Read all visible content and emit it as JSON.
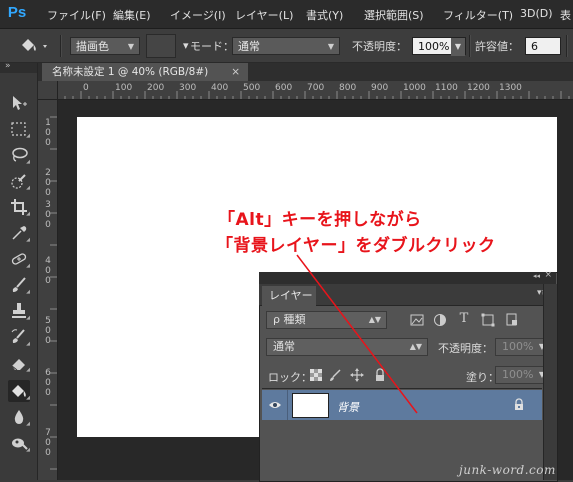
{
  "menubar": {
    "app_logo": "Ps",
    "items": [
      "ファイル(F)",
      "編集(E)",
      "イメージ(I)",
      "レイヤー(L)",
      "書式(Y)",
      "選択範囲(S)",
      "フィルター(T)",
      "3D(D)",
      "表"
    ]
  },
  "options": {
    "mode_value": "描画色",
    "mode_label": "モード：",
    "blend_value": "通常",
    "opacity_label": "不透明度：",
    "opacity_value": "100%",
    "tolerance_label": "許容値：",
    "tolerance_value": "6"
  },
  "toolbar": {
    "header": "»",
    "tools": [
      "move-tool",
      "marquee-tool",
      "lasso-tool",
      "quick-selection-tool",
      "crop-tool",
      "eyedropper-tool",
      "healing-brush-tool",
      "brush-tool",
      "clone-stamp-tool",
      "history-brush-tool",
      "eraser-tool",
      "paint-bucket-tool",
      "blur-tool",
      "dodge-tool"
    ],
    "active_tool": "paint-bucket-tool"
  },
  "document": {
    "tab_title": "名称未設定 1 @ 40% (RGB/8#)",
    "close_glyph": "×"
  },
  "rulers": {
    "h_labels": [
      "0",
      "100",
      "200",
      "300",
      "400",
      "500",
      "600",
      "700",
      "800",
      "900",
      "1000",
      "1100",
      "1200",
      "1300"
    ],
    "v_labels": [
      [
        "1",
        "0",
        "0"
      ],
      [
        "2",
        "0",
        "0"
      ],
      [
        "3",
        "0",
        "0"
      ],
      [
        "4",
        "0",
        "0"
      ],
      [
        "5",
        "0",
        "0"
      ],
      [
        "6",
        "0",
        "0"
      ],
      [
        "7",
        "0",
        "0"
      ]
    ]
  },
  "annotation": {
    "line1": "「Alt」キーを押しながら",
    "line2": "「背景レイヤー」をダブルクリック",
    "color": "#e8141b"
  },
  "layers_panel": {
    "tab_label": "レイヤー",
    "collapse_glyph": "◂◂",
    "close_glyph": "×",
    "menu_glyph": "▾≡",
    "filter_value": "ρ 種類",
    "blend_value": "通常",
    "opacity_label": "不透明度：",
    "opacity_value": "100%",
    "lock_label": "ロック：",
    "fill_label": "塗り：",
    "fill_value": "100%",
    "layers": [
      {
        "name": "背景",
        "visible": true,
        "locked": true,
        "selected": true
      }
    ]
  },
  "watermark": "junk-word.com"
}
